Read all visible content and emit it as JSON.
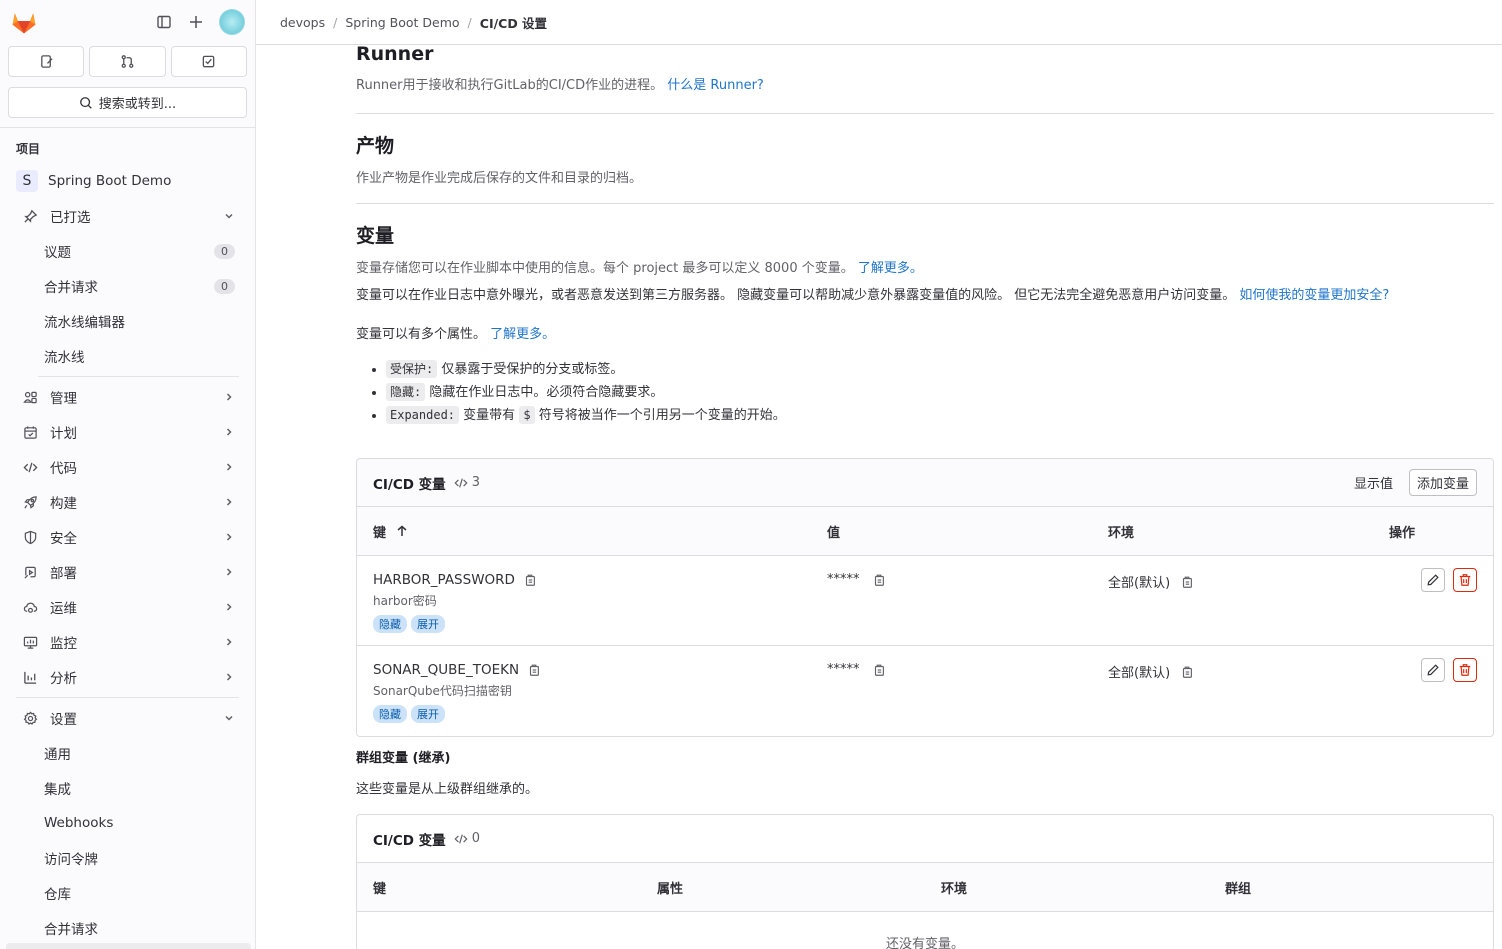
{
  "sidebar": {
    "search_label": "搜索或转到...",
    "section_title": "项目",
    "project_initial": "S",
    "project_name": "Spring Boot Demo",
    "pinned": {
      "label": "已打选",
      "items": [
        {
          "label": "议题",
          "count": "0"
        },
        {
          "label": "合并请求",
          "count": "0"
        },
        {
          "label": "流水线编辑器"
        },
        {
          "label": "流水线"
        }
      ]
    },
    "nav": [
      {
        "label": "管理",
        "icon": "users-icon"
      },
      {
        "label": "计划",
        "icon": "calendar-icon"
      },
      {
        "label": "代码",
        "icon": "code-icon"
      },
      {
        "label": "构建",
        "icon": "rocket-icon"
      },
      {
        "label": "安全",
        "icon": "shield-icon"
      },
      {
        "label": "部署",
        "icon": "deploy-icon"
      },
      {
        "label": "运维",
        "icon": "cloud-gear-icon"
      },
      {
        "label": "监控",
        "icon": "monitor-icon"
      },
      {
        "label": "分析",
        "icon": "chart-icon"
      }
    ],
    "settings": {
      "label": "设置",
      "items": [
        "通用",
        "集成",
        "Webhooks",
        "访问令牌",
        "仓库",
        "合并请求"
      ]
    }
  },
  "breadcrumb": {
    "items": [
      "devops",
      "Spring Boot Demo"
    ],
    "current": "CI/CD 设置"
  },
  "runner": {
    "title": "Runner",
    "desc": "Runner用于接收和执行GitLab的CI/CD作业的进程。",
    "link": "什么是 Runner?"
  },
  "artifacts": {
    "title": "产物",
    "desc": "作业产物是作业完成后保存的文件和目录的归档。"
  },
  "variables": {
    "title": "变量",
    "desc1": "变量存储您可以在作业脚本中使用的信息。每个 project 最多可以定义 8000 个变量。",
    "desc1_link": "了解更多。",
    "desc2": "变量可以在作业日志中意外曝光，或者恶意发送到第三方服务器。 隐藏变量可以帮助减少意外暴露变量值的风险。 但它无法完全避免恶意用户访问变量。",
    "desc2_link": "如何使我的变量更加安全?",
    "desc3": "变量可以有多个属性。",
    "desc3_link": "了解更多。",
    "bullets": [
      {
        "code": "受保护:",
        "text": "仅暴露于受保护的分支或标签。"
      },
      {
        "code": "隐藏:",
        "text": "隐藏在作业日志中。必须符合隐藏要求。"
      },
      {
        "code": "Expanded:",
        "text": "变量带有",
        "code2": "$",
        "text2": "符号将被当作一个引用另一个变量的开始。"
      }
    ]
  },
  "cicd_card": {
    "title": "CI/CD 变量",
    "count": "3",
    "reveal_label": "显示值",
    "add_label": "添加变量",
    "columns": [
      "键",
      "值",
      "环境",
      "操作"
    ],
    "rows": [
      {
        "key": "HARBOR_PASSWORD",
        "desc": "harbor密码",
        "value": "*****",
        "env": "全部(默认)",
        "badges": [
          "隐藏",
          "展开"
        ]
      },
      {
        "key": "SONAR_QUBE_TOEKN",
        "desc": "SonarQube代码扫描密钥",
        "value": "*****",
        "env": "全部(默认)",
        "badges": [
          "隐藏",
          "展开"
        ]
      }
    ]
  },
  "group_vars": {
    "title": "群组变量 (继承)",
    "desc": "这些变量是从上级群组继承的。",
    "card_title": "CI/CD 变量",
    "count": "0",
    "columns": [
      "键",
      "属性",
      "环境",
      "群组"
    ],
    "empty": "还没有变量。"
  }
}
